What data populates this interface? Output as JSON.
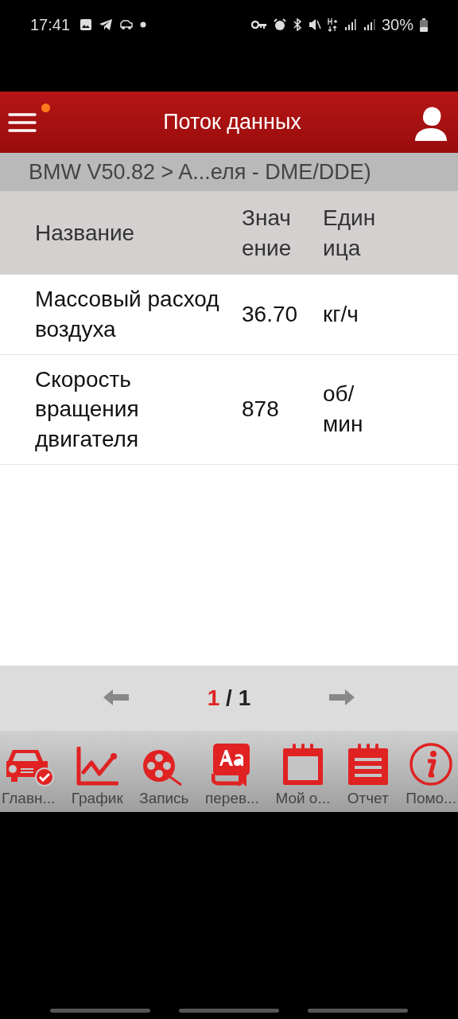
{
  "status_bar": {
    "time": "17:41",
    "battery": "30%"
  },
  "header": {
    "title": "Поток данных",
    "notification": true
  },
  "breadcrumb": "BMW V50.82 > A...еля - DME/DDE)",
  "table": {
    "columns": [
      "Название",
      "Значение",
      "Единица"
    ],
    "rows": [
      {
        "name": "Массовый расход воздуха",
        "value": "36.70",
        "unit": "кг/ч"
      },
      {
        "name": "Скорость вращения двигателя",
        "value": "878",
        "unit": "об/ мин"
      }
    ]
  },
  "pager": {
    "current": "1",
    "separator": "/",
    "total": "1"
  },
  "nav": [
    {
      "kind": "car",
      "label": "Главн..."
    },
    {
      "kind": "chart",
      "label": "График"
    },
    {
      "kind": "reel",
      "label": "Запись"
    },
    {
      "kind": "dictionary",
      "label": "перев..."
    },
    {
      "kind": "calendar",
      "label": "Мой о..."
    },
    {
      "kind": "report",
      "label": "Отчет"
    },
    {
      "kind": "info",
      "label": "Помо..."
    }
  ]
}
